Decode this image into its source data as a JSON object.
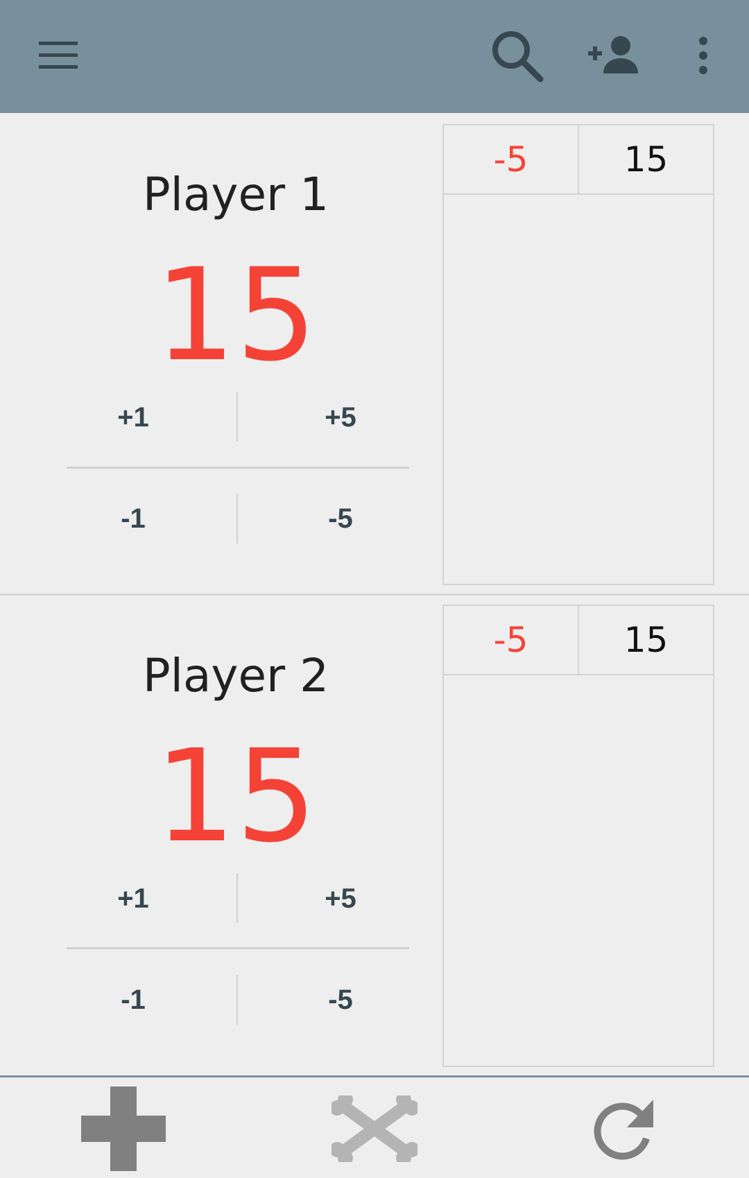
{
  "toolbar": {
    "background": "#78909c",
    "icon_color": "#37474f",
    "icons": [
      "menu-icon",
      "search-icon",
      "add-person-icon",
      "more-vert-icon"
    ]
  },
  "players": [
    {
      "name": "Player 1",
      "score": "15",
      "buttons": {
        "plus1": "+1",
        "plus5": "+5",
        "minus1": "-1",
        "minus5": "-5"
      },
      "history_header": {
        "delta": "-5",
        "total": "15"
      }
    },
    {
      "name": "Player 2",
      "score": "15",
      "buttons": {
        "plus1": "+1",
        "plus5": "+5",
        "minus1": "-1",
        "minus5": "-5"
      },
      "history_header": {
        "delta": "-5",
        "total": "15"
      }
    }
  ],
  "colors": {
    "score": "#f44336",
    "background": "#eeeeee"
  },
  "bottom_actions": [
    "add-icon",
    "crossbones-icon",
    "refresh-icon"
  ]
}
